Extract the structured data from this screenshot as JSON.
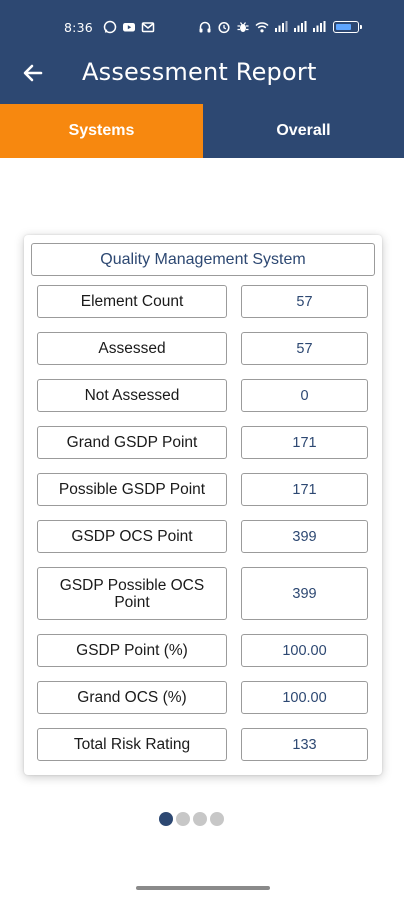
{
  "status_bar": {
    "time": "8:36",
    "left_icons": [
      "whatsapp-icon",
      "youtube-icon",
      "gmail-icon"
    ],
    "right_icons": [
      "headphones-icon",
      "alarm-icon",
      "bug-icon",
      "wifi-icon",
      "signal-icon",
      "signal-icon",
      "signal-icon",
      "battery-icon"
    ],
    "battery_level": 0.8
  },
  "header": {
    "title": "Assessment Report",
    "back_icon": "arrow-left-icon"
  },
  "tabs": [
    {
      "label": "Systems",
      "active": true
    },
    {
      "label": "Overall",
      "active": false
    }
  ],
  "card": {
    "title": "Quality Management System",
    "rows": [
      {
        "label": "Element Count",
        "value": "57"
      },
      {
        "label": "Assessed",
        "value": "57"
      },
      {
        "label": "Not Assessed",
        "value": "0"
      },
      {
        "label": "Grand GSDP Point",
        "value": "171"
      },
      {
        "label": "Possible GSDP Point",
        "value": "171"
      },
      {
        "label": "GSDP OCS Point",
        "value": "399"
      },
      {
        "label": "GSDP Possible OCS Point",
        "value": "399"
      },
      {
        "label": "GSDP Point (%)",
        "value": "100.00"
      },
      {
        "label": "Grand OCS (%)",
        "value": "100.00"
      },
      {
        "label": "Total Risk Rating",
        "value": "133"
      }
    ]
  },
  "pagination": {
    "total": 4,
    "active_index": 0
  },
  "colors": {
    "header": "#2d4872",
    "tab_active": "#f7880f",
    "value_text": "#2d4872",
    "dot_inactive": "#c7c7c7"
  }
}
